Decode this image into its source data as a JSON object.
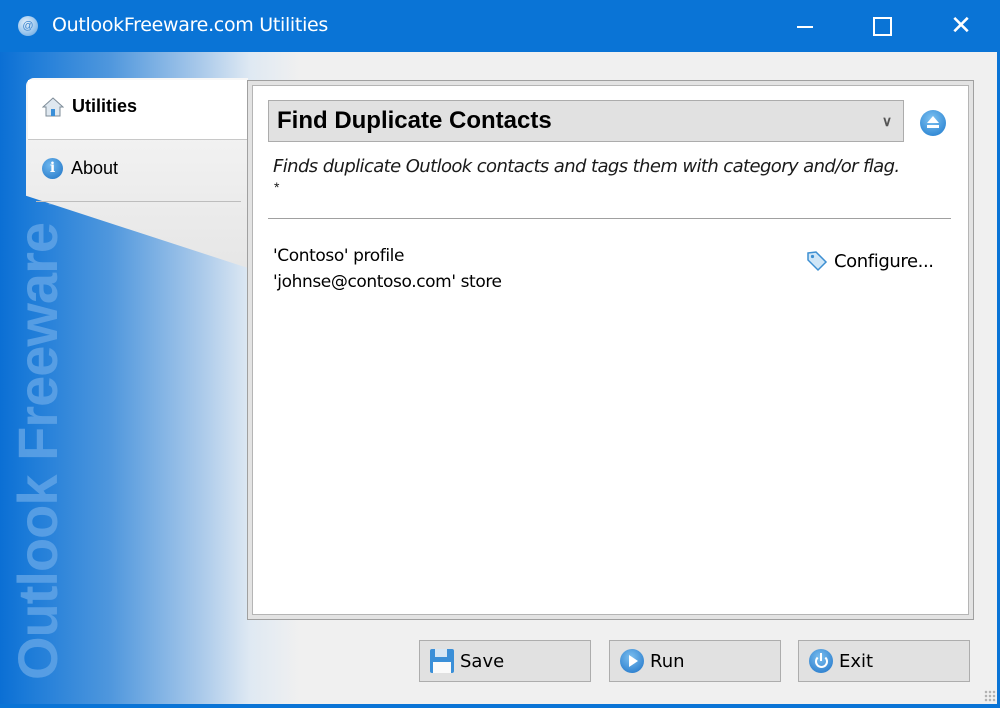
{
  "window": {
    "title": "OutlookFreeware.com Utilities",
    "controls": {
      "minimize": "minimize",
      "maximize": "maximize",
      "close": "close"
    },
    "accent_color": "#0a74d6"
  },
  "branding": {
    "vertical_text": "Outlook Freeware .com"
  },
  "sidebar": {
    "items": [
      {
        "label": "Utilities",
        "icon": "home-icon",
        "active": true
      },
      {
        "label": "About",
        "icon": "info-icon",
        "active": false
      }
    ]
  },
  "main": {
    "utility_select": {
      "selected": "Find Duplicate Contacts"
    },
    "description": "Finds duplicate Outlook contacts and tags them with category and/or flag.",
    "description_note": "*",
    "profile_line": "'Contoso' profile",
    "store_line": "'johnse@contoso.com' store",
    "configure_label": "Configure..."
  },
  "footer": {
    "save_label": "Save",
    "run_label": "Run",
    "exit_label": "Exit"
  }
}
